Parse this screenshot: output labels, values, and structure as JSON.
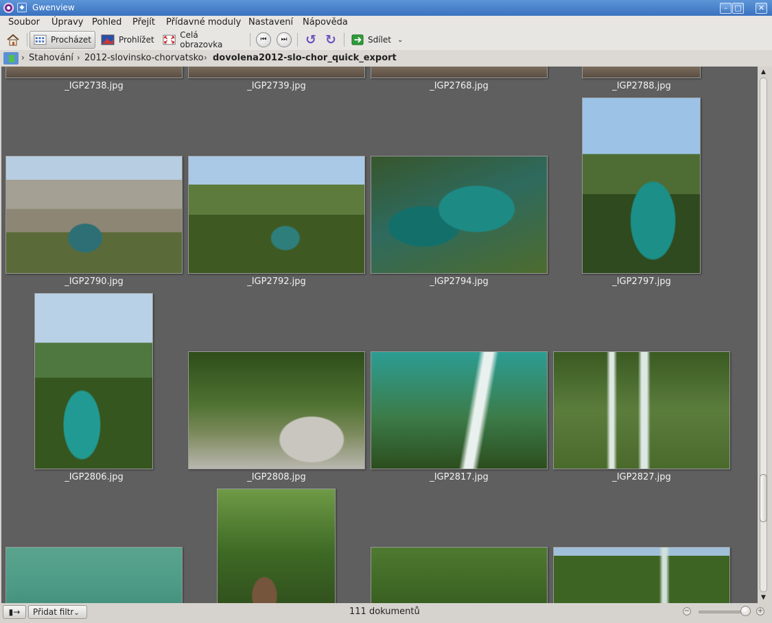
{
  "window": {
    "title": "Gwenview"
  },
  "menu": [
    "Soubor",
    "Úpravy",
    "Pohled",
    "Přejít",
    "Přídavné moduly",
    "Nastavení",
    "Nápověda"
  ],
  "toolbar": {
    "browse": "Procházet",
    "view": "Prohlížet",
    "fullscreen": "Celá obrazovka",
    "share": "Sdílet"
  },
  "breadcrumb": {
    "parts": [
      "Stahování",
      "2012-slovinsko-chorvatsko",
      "dovolena2012-slo-chor_quick_export"
    ]
  },
  "thumbnails": [
    {
      "name": "_IGP2738.jpg"
    },
    {
      "name": "_IGP2739.jpg"
    },
    {
      "name": "_IGP2768.jpg"
    },
    {
      "name": "_IGP2788.jpg"
    },
    {
      "name": "_IGP2790.jpg"
    },
    {
      "name": "_IGP2792.jpg"
    },
    {
      "name": "_IGP2794.jpg"
    },
    {
      "name": "_IGP2797.jpg"
    },
    {
      "name": "_IGP2806.jpg"
    },
    {
      "name": "_IGP2808.jpg"
    },
    {
      "name": "_IGP2817.jpg"
    },
    {
      "name": "_IGP2827.jpg"
    }
  ],
  "statusbar": {
    "filter_button": "Přidat filtr",
    "count": "111 dokumentů"
  }
}
